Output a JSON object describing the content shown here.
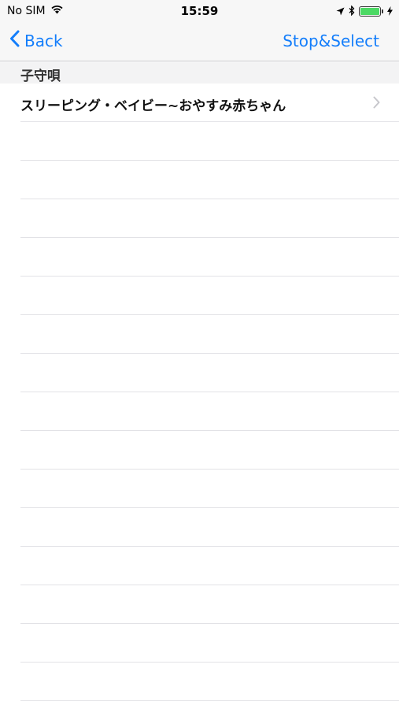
{
  "status_bar": {
    "carrier": "No SIM",
    "time": "15:59",
    "battery_level": 1.0,
    "icons": [
      "wifi-icon",
      "location-arrow-icon",
      "bluetooth-icon",
      "battery-icon",
      "charging-bolt-icon"
    ]
  },
  "nav": {
    "back_label": "Back",
    "action_label": "Stop&Select"
  },
  "section": {
    "header": "子守唄"
  },
  "rows": [
    {
      "title": "スリーピング・ベイビー~おやすみ赤ちゃん",
      "has_disclosure": true
    }
  ],
  "empty_row_count": 15,
  "colors": {
    "accent": "#147efb",
    "battery": "#4cd964",
    "separator": "#e2e2e6",
    "bar_background": "#f7f7f7"
  }
}
